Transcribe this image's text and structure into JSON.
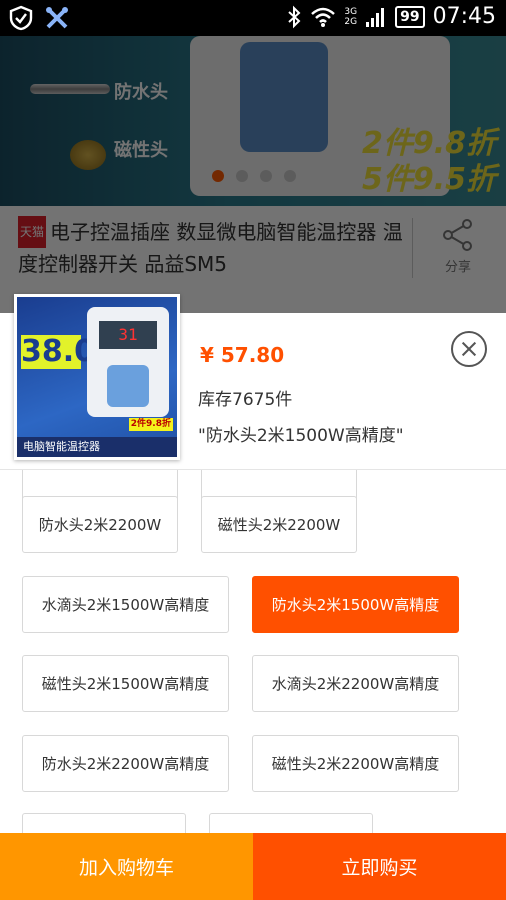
{
  "status_bar": {
    "time": "07:45",
    "battery": "99",
    "network_top": "3G",
    "network_bottom": "2G"
  },
  "banner": {
    "labels": [
      "防水头",
      "磁性头"
    ],
    "discount_lines": [
      "2件9.8折",
      "5件9.5折"
    ]
  },
  "product": {
    "store_badge": "天猫",
    "title": "电子控温插座 数显微电脑智能温控器 温度控制器开关 品益SM5",
    "share_label": "分享"
  },
  "sheet": {
    "thumb_price": "38.00",
    "thumb_screen": "31",
    "thumb_footer": "电脑智能温控器",
    "thumb_discount": "2件9.8折",
    "price": "¥ 57.80",
    "stock": "库存7675件",
    "selected": "\"防水头2米1500W高精度\""
  },
  "options": [
    {
      "label": ""
    },
    {
      "label": ""
    },
    {
      "label": "防水头2米2200W"
    },
    {
      "label": "磁性头2米2200W"
    },
    {
      "label": "水滴头2米1500W高精度"
    },
    {
      "label": "防水头2米1500W高精度",
      "selected": true
    },
    {
      "label": "磁性头2米1500W高精度"
    },
    {
      "label": "水滴头2米2200W高精度"
    },
    {
      "label": "防水头2米2200W高精度"
    },
    {
      "label": "磁性头2米2200W高精度"
    },
    {
      "label": ""
    },
    {
      "label": ""
    }
  ],
  "actions": {
    "add_to_cart": "加入购物车",
    "buy_now": "立即购买"
  },
  "colors": {
    "accent": "#ff5000",
    "cart": "#ff9600",
    "discount": "#f2e33a"
  }
}
